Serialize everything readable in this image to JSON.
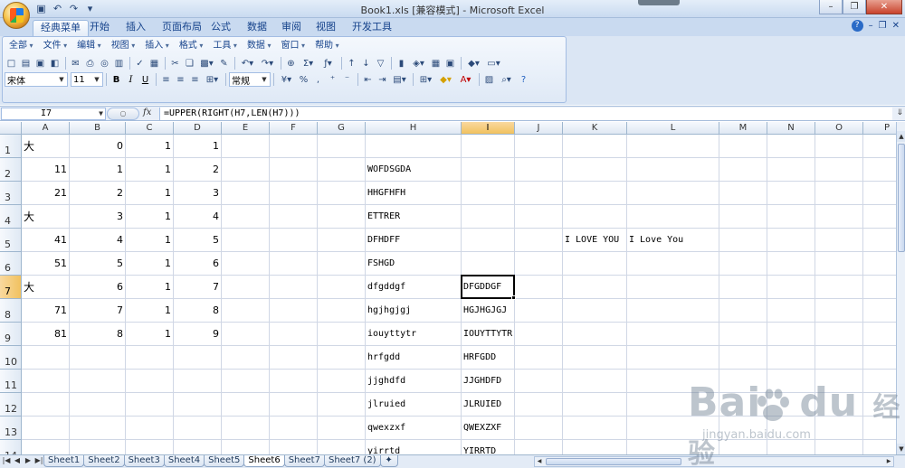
{
  "title": "Book1.xls  [兼容模式] - Microsoft Excel",
  "qat": [
    "save-icon",
    "undo-icon",
    "redo-icon",
    "customize-icon"
  ],
  "ribbon_tabs": [
    "经典菜单",
    "开始",
    "插入",
    "页面布局",
    "公式",
    "数据",
    "审阅",
    "视图",
    "开发工具"
  ],
  "classic_menu": [
    "全部",
    "文件",
    "编辑",
    "视图",
    "插入",
    "格式",
    "工具",
    "数据",
    "窗口",
    "帮助"
  ],
  "font_name": "宋体",
  "font_size": "11",
  "number_format": "常规",
  "name_box": "I7",
  "fx_label": "fx",
  "formula": "=UPPER(RIGHT(H7,LEN(H7)))",
  "columns": [
    "A",
    "B",
    "C",
    "D",
    "E",
    "F",
    "G",
    "H",
    "I",
    "J",
    "K",
    "L",
    "M",
    "N",
    "O",
    "P"
  ],
  "rows": [
    "1",
    "2",
    "3",
    "4",
    "5",
    "6",
    "7",
    "8",
    "9",
    "10",
    "11",
    "12",
    "13",
    "14"
  ],
  "cells": {
    "A1": "大",
    "B1": "0",
    "C1": "1",
    "D1": "1",
    "A2": "11",
    "B2": "1",
    "C2": "1",
    "D2": "2",
    "H2": "WOFDSGDA",
    "A3": "21",
    "B3": "2",
    "C3": "1",
    "D3": "3",
    "H3": "HHGFHFH",
    "A4": "大",
    "B4": "3",
    "C4": "1",
    "D4": "4",
    "H4": "ETTRER",
    "A5": "41",
    "B5": "4",
    "C5": "1",
    "D5": "5",
    "H5": "DFHDFF",
    "K5": "I LOVE YOU",
    "L5": "I Love You",
    "A6": "51",
    "B6": "5",
    "C6": "1",
    "D6": "6",
    "H6": "FSHGD",
    "A7": "大",
    "B7": "6",
    "C7": "1",
    "D7": "7",
    "H7": "dfgddgf",
    "I7": "DFGDDGF",
    "A8": "71",
    "B8": "7",
    "C8": "1",
    "D8": "8",
    "H8": "hgjhgjgj",
    "I8": "HGJHGJGJ",
    "A9": "81",
    "B9": "8",
    "C9": "1",
    "D9": "9",
    "H9": "iouyttytr",
    "I9": "IOUYTTYTR",
    "H10": "hrfgdd",
    "I10": "HRFGDD",
    "H11": "jjghdfd",
    "I11": "JJGHDFD",
    "H12": "jlruied",
    "I12": "JLRUIED",
    "H13": "qwexzxf",
    "I13": "QWEXZXF",
    "H14": "yirrtd",
    "I14": "YIRRTD"
  },
  "sheets": [
    "Sheet1",
    "Sheet2",
    "Sheet3",
    "Sheet4",
    "Sheet5",
    "Sheet6",
    "Sheet7",
    "Sheet7 (2)"
  ],
  "active_sheet": "Sheet6",
  "watermark": {
    "logo": "Bai",
    "logo2": "du",
    "cn": "经验",
    "url": "jingyan.baidu.com"
  }
}
